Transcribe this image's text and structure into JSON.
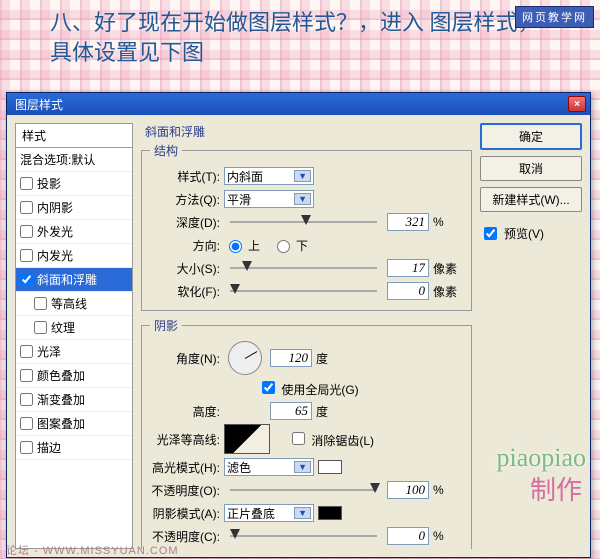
{
  "page": {
    "overlay_text": "八、好了现在开始做图层样式？，进入\n图层样式，具体设置见下图",
    "badge": "网页教学网",
    "footer": "论坛 - WWW.MISSYUAN.COM"
  },
  "dialog": {
    "title": "图层样式"
  },
  "styles": {
    "header": "样式",
    "blend_label": "混合选项:默认",
    "items": [
      {
        "key": "drop_shadow",
        "label": "投影",
        "checked": false
      },
      {
        "key": "inner_shadow",
        "label": "内阴影",
        "checked": false
      },
      {
        "key": "outer_glow",
        "label": "外发光",
        "checked": false
      },
      {
        "key": "inner_glow",
        "label": "内发光",
        "checked": false
      },
      {
        "key": "bevel",
        "label": "斜面和浮雕",
        "checked": true,
        "selected": true
      },
      {
        "key": "contour",
        "label": "等高线",
        "checked": false,
        "sub": true
      },
      {
        "key": "texture",
        "label": "纹理",
        "checked": false,
        "sub": true
      },
      {
        "key": "satin",
        "label": "光泽",
        "checked": false
      },
      {
        "key": "color_overlay",
        "label": "颜色叠加",
        "checked": false
      },
      {
        "key": "gradient_overlay",
        "label": "渐变叠加",
        "checked": false
      },
      {
        "key": "pattern_overlay",
        "label": "图案叠加",
        "checked": false
      },
      {
        "key": "stroke",
        "label": "描边",
        "checked": false
      }
    ]
  },
  "panel_title": "斜面和浮雕",
  "structure": {
    "legend": "结构",
    "style_label": "样式(T):",
    "style_value": "内斜面",
    "technique_label": "方法(Q):",
    "technique_value": "平滑",
    "depth_label": "深度(D):",
    "depth_value": "321",
    "depth_unit": "%",
    "direction_label": "方向:",
    "direction_up": "上",
    "direction_down": "下",
    "direction_value": "up",
    "size_label": "大小(S):",
    "size_value": "17",
    "size_unit": "像素",
    "soften_label": "软化(F):",
    "soften_value": "0",
    "soften_unit": "像素"
  },
  "shading": {
    "legend": "阴影",
    "angle_label": "角度(N):",
    "angle_value": "120",
    "angle_unit": "度",
    "global_label": "使用全局光(G)",
    "global_checked": true,
    "altitude_label": "高度:",
    "altitude_value": "65",
    "altitude_unit": "度",
    "gloss_label": "光泽等高线:",
    "anti_alias_label": "消除锯齿(L)",
    "anti_alias_checked": false,
    "highlight_mode_label": "高光模式(H):",
    "highlight_mode_value": "滤色",
    "highlight_color": "#ffffff",
    "highlight_opacity_label": "不透明度(O):",
    "highlight_opacity_value": "100",
    "highlight_opacity_unit": "%",
    "shadow_mode_label": "阴影模式(A):",
    "shadow_mode_value": "正片叠底",
    "shadow_color": "#000000",
    "shadow_opacity_label": "不透明度(C):",
    "shadow_opacity_value": "0",
    "shadow_opacity_unit": "%"
  },
  "buttons": {
    "ok": "确定",
    "cancel": "取消",
    "new_style": "新建样式(W)...",
    "preview_label": "预览(V)",
    "preview_checked": true
  },
  "watermark": {
    "text1": "piaopiao",
    "text2": "制作"
  }
}
